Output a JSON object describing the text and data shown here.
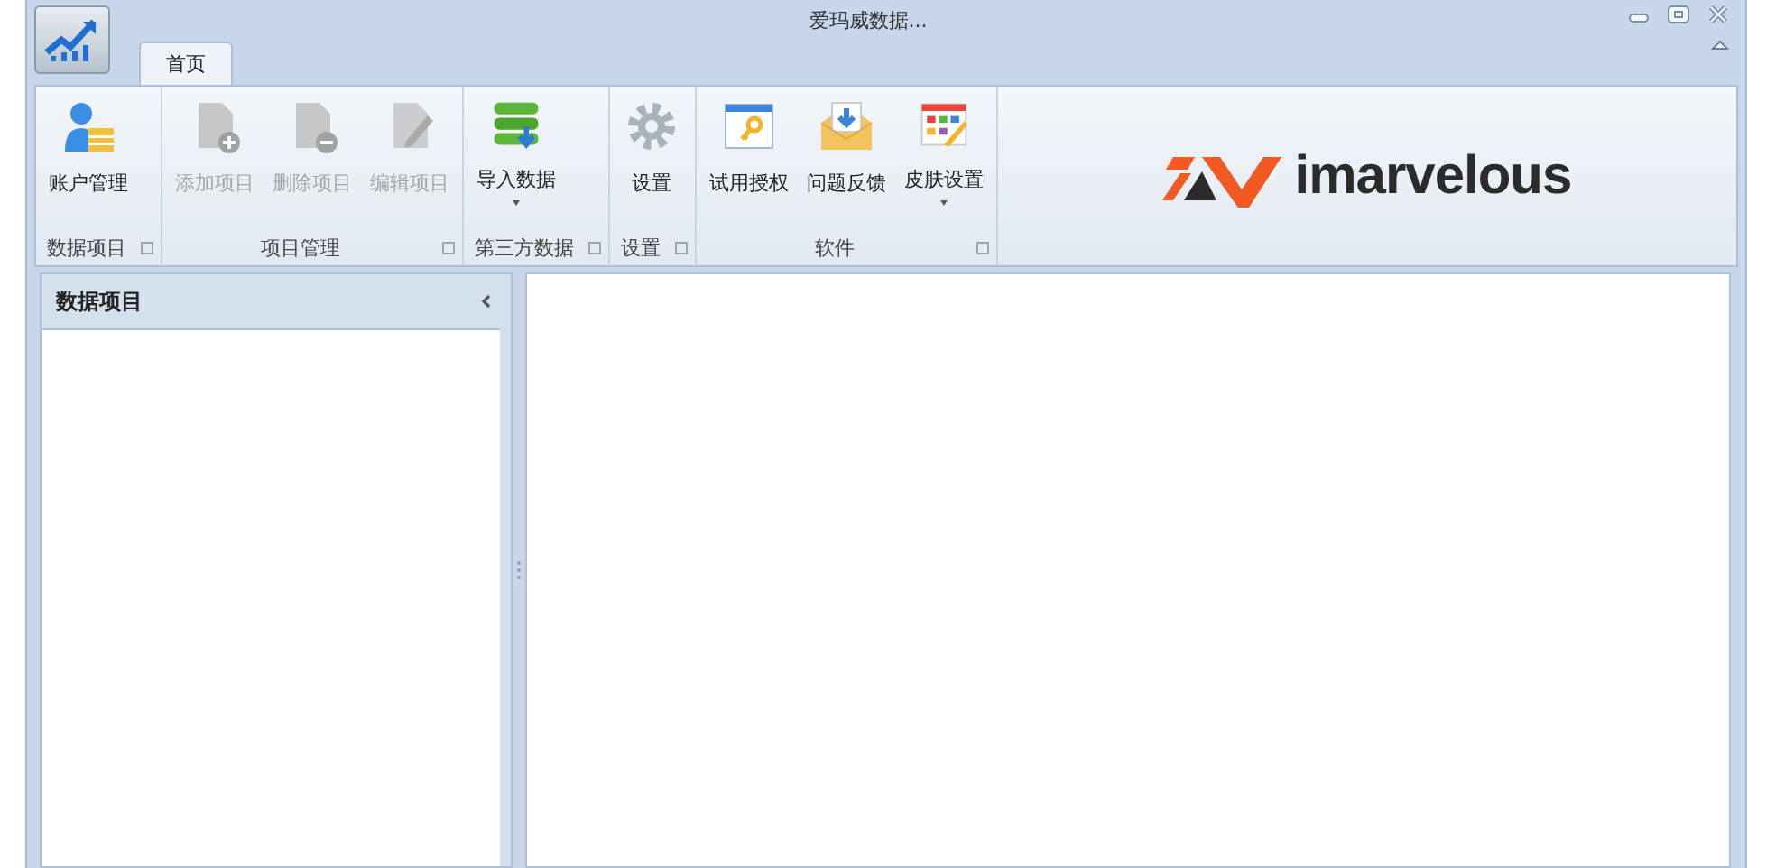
{
  "window": {
    "title": "爱玛威数据..."
  },
  "tabs": [
    {
      "label": "首页",
      "selected": true
    }
  ],
  "ribbon": {
    "groups": [
      {
        "label": "数据项目",
        "launcher": true,
        "buttons": [
          {
            "label": "账户管理",
            "disabled": false,
            "dropdown": false
          }
        ]
      },
      {
        "label": "项目管理",
        "launcher": true,
        "buttons": [
          {
            "label": "添加项目",
            "disabled": true,
            "dropdown": false
          },
          {
            "label": "删除项目",
            "disabled": true,
            "dropdown": false
          },
          {
            "label": "编辑项目",
            "disabled": true,
            "dropdown": false
          }
        ]
      },
      {
        "label": "第三方数据",
        "launcher": true,
        "buttons": [
          {
            "label": "导入数据",
            "disabled": false,
            "dropdown": true
          }
        ]
      },
      {
        "label": "设置",
        "launcher": true,
        "buttons": [
          {
            "label": "设置",
            "disabled": false,
            "dropdown": false
          }
        ]
      },
      {
        "label": "软件",
        "launcher": true,
        "buttons": [
          {
            "label": "试用授权",
            "disabled": false,
            "dropdown": false
          },
          {
            "label": "问题反馈",
            "disabled": false,
            "dropdown": false
          },
          {
            "label": "皮肤设置",
            "disabled": false,
            "dropdown": true
          }
        ]
      }
    ],
    "logo": "imarvelous"
  },
  "side_panel": {
    "title": "数据项目"
  }
}
